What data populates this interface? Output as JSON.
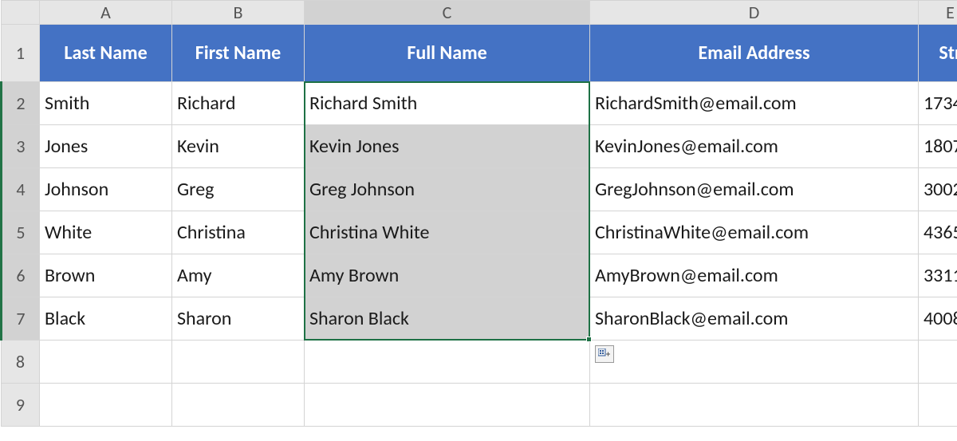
{
  "columns": [
    "A",
    "B",
    "C",
    "D",
    "E"
  ],
  "rows": [
    "1",
    "2",
    "3",
    "4",
    "5",
    "6",
    "7",
    "8",
    "9"
  ],
  "headers": {
    "A": "Last Name",
    "B": "First Name",
    "C": "Full Name",
    "D": "Email Address",
    "E": "Str"
  },
  "data": [
    {
      "A": "Smith",
      "B": "Richard",
      "C": "Richard Smith",
      "D": "RichardSmith@email.com",
      "E": "1734"
    },
    {
      "A": "Jones",
      "B": "Kevin",
      "C": "Kevin Jones",
      "D": "KevinJones@email.com",
      "E": "1807"
    },
    {
      "A": "Johnson",
      "B": "Greg",
      "C": "Greg Johnson",
      "D": "GregJohnson@email.com",
      "E": "3002"
    },
    {
      "A": "White",
      "B": "Christina",
      "C": "Christina White",
      "D": "ChristinaWhite@email.com",
      "E": "4365"
    },
    {
      "A": "Brown",
      "B": "Amy",
      "C": "Amy Brown",
      "D": "AmyBrown@email.com",
      "E": "3311"
    },
    {
      "A": "Black",
      "B": "Sharon",
      "C": "Sharon Black",
      "D": "SharonBlack@email.com",
      "E": "4008"
    }
  ],
  "selection": {
    "col": "C",
    "startRow": 2,
    "endRow": 7
  },
  "colors": {
    "header_fill": "#4472C4",
    "sel_border": "#1e7145"
  }
}
